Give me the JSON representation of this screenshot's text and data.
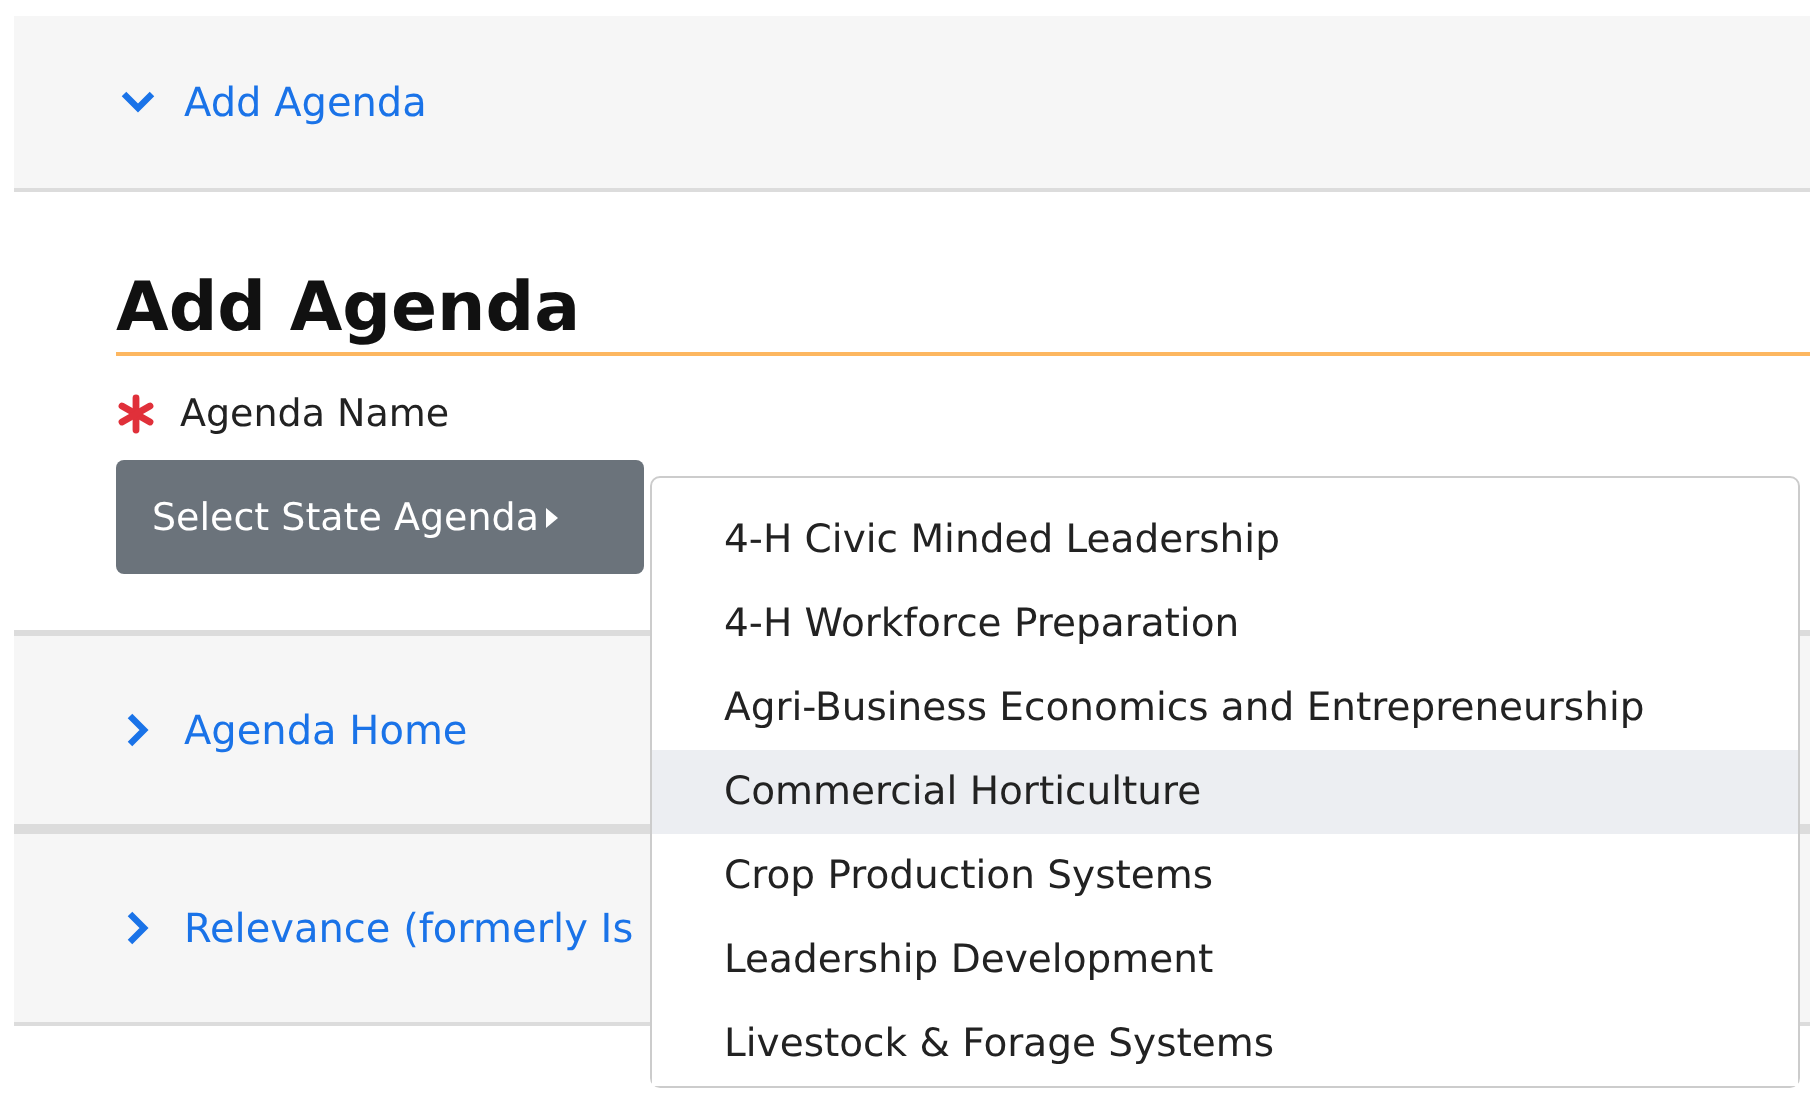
{
  "panels": [
    {
      "title": "Add Agenda",
      "expanded": true
    },
    {
      "title": "Agenda Home",
      "expanded": false
    },
    {
      "title": "Relevance (formerly Is",
      "expanded": false
    }
  ],
  "form": {
    "heading": "Add Agenda",
    "field_label": "Agenda Name",
    "required": true,
    "button": "Select State Agenda"
  },
  "dropdown": {
    "items": [
      {
        "label": "4-H Civic Minded Leadership",
        "selected": false
      },
      {
        "label": "4-H Workforce Preparation",
        "selected": false
      },
      {
        "label": "Agri-Business Economics and Entrepreneurship",
        "selected": false
      },
      {
        "label": "Commercial Horticulture",
        "selected": true
      },
      {
        "label": "Crop Production Systems",
        "selected": false
      },
      {
        "label": "Leadership Development",
        "selected": false
      },
      {
        "label": "Livestock & Forage Systems",
        "selected": false
      }
    ]
  }
}
